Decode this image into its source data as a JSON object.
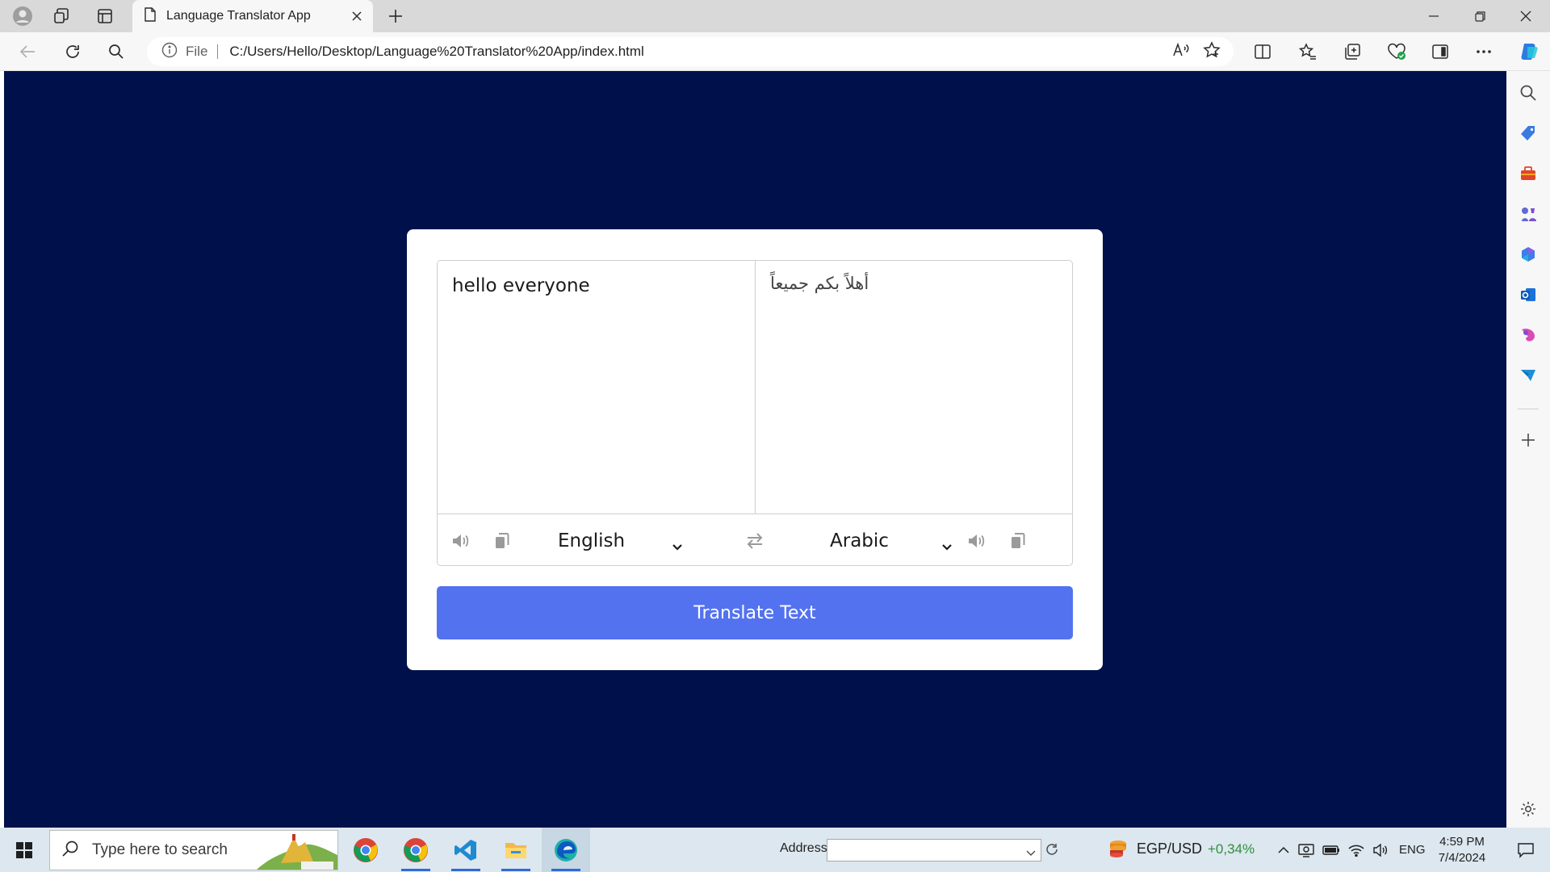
{
  "browser": {
    "tab_title": "Language Translator App",
    "address_scheme": "File",
    "address_url": "C:/Users/Hello/Desktop/Language%20Translator%20App/index.html"
  },
  "app": {
    "from_text": "hello everyone",
    "to_text": "أهلاً بكم جميعاً",
    "from_language": "English",
    "to_language": "Arabic",
    "translate_label": "Translate Text",
    "background_color": "#00104a",
    "button_color": "#5372f0"
  },
  "taskbar": {
    "search_placeholder": "Type here to search",
    "address_label": "Address",
    "ticker_symbol": "EGP/USD",
    "ticker_change": "+0,34%",
    "language": "ENG",
    "time": "4:59 PM",
    "date": "7/4/2024"
  }
}
